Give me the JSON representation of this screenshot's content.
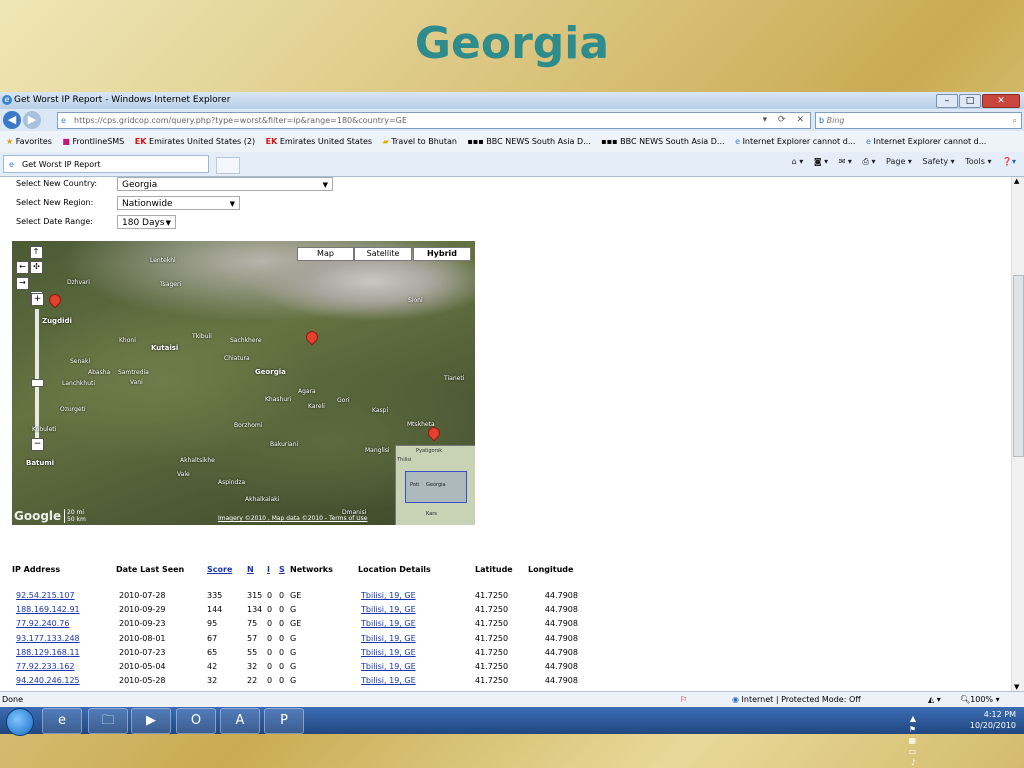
{
  "slide_title": "Georgia",
  "browser": {
    "window_title": "Get Worst IP Report - Windows Internet Explorer",
    "url": "https://cps.gridcop.com/query.php?type=worst&filter=ip&range=180&country=GE",
    "search_placeholder": "Bing",
    "favorites_label": "Favorites",
    "favorites": [
      "FrontlineSMS",
      "Emirates United States (2)",
      "Emirates United States",
      "Travel to Bhutan",
      "BBC NEWS South Asia D...",
      "BBC NEWS South Asia D...",
      "Internet Explorer cannot d...",
      "Internet Explorer cannot d..."
    ],
    "tab_title": "Get Worst IP Report",
    "commands": [
      "Page ▾",
      "Safety ▾",
      "Tools ▾"
    ],
    "status_left": "Done",
    "status_zone": "Internet | Protected Mode: Off",
    "zoom": "100%"
  },
  "form": {
    "country_label": "Select New Country:",
    "country_value": "Georgia",
    "region_label": "Select New Region:",
    "region_value": "Nationwide",
    "range_label": "Select Date Range:",
    "range_value": "180 Days"
  },
  "map": {
    "types": [
      "Map",
      "Satellite",
      "Hybrid"
    ],
    "active_type": "Hybrid",
    "place_labels": [
      "Lentekhi",
      "Dzhvari",
      "Tsageri",
      "Zugdidi",
      "Khoni",
      "Kutaisi",
      "Tkibuli",
      "Sachkhere",
      "Chiatura",
      "Georgia",
      "Senaki",
      "Abasha",
      "Samtredia",
      "Lanchkhuti",
      "Vani",
      "Ozurgeti",
      "Kobuleti",
      "Batumi",
      "Khashuri",
      "Agara",
      "Kareli",
      "Gori",
      "Kaspi",
      "Mtskheta",
      "Borzhomi",
      "Bakuriani",
      "Akhaltsikhe",
      "Vale",
      "Aspindza",
      "Akhalkalaki",
      "Dmanisi",
      "Manglisi",
      "Tianeti",
      "Sioni",
      "Pyatigorsk",
      "Thilisi",
      "Poti",
      "Kars"
    ],
    "scale_mi": "20 mi",
    "scale_km": "50 km",
    "copyright": "Imagery ©2010 , Map data ©2010 - Terms of Use",
    "logo": "Google"
  },
  "table": {
    "headers": {
      "ip": "IP Address",
      "date": "Date Last Seen",
      "score": "Score",
      "n": "N",
      "i": "I",
      "s": "S",
      "networks": "Networks",
      "location": "Location Details",
      "lat": "Latitude",
      "lon": "Longitude"
    },
    "rows": [
      {
        "ip": "92.54.215.107",
        "date": "2010-07-28",
        "score": "335",
        "n": "315",
        "i": "0",
        "s": "0",
        "networks": "GE",
        "location": "Tbilisi, 19, GE",
        "lat": "41.7250",
        "lon": "44.7908"
      },
      {
        "ip": "188.169.142.91",
        "date": "2010-09-29",
        "score": "144",
        "n": "134",
        "i": "0",
        "s": "0",
        "networks": "G",
        "location": "Tbilisi, 19, GE",
        "lat": "41.7250",
        "lon": "44.7908"
      },
      {
        "ip": "77.92.240.76",
        "date": "2010-09-23",
        "score": "95",
        "n": "75",
        "i": "0",
        "s": "0",
        "networks": "GE",
        "location": "Tbilisi, 19, GE",
        "lat": "41.7250",
        "lon": "44.7908"
      },
      {
        "ip": "93.177.133.248",
        "date": "2010-08-01",
        "score": "67",
        "n": "57",
        "i": "0",
        "s": "0",
        "networks": "G",
        "location": "Tbilisi, 19, GE",
        "lat": "41.7250",
        "lon": "44.7908"
      },
      {
        "ip": "188.129.168.11",
        "date": "2010-07-23",
        "score": "65",
        "n": "55",
        "i": "0",
        "s": "0",
        "networks": "G",
        "location": "Tbilisi, 19, GE",
        "lat": "41.7250",
        "lon": "44.7908"
      },
      {
        "ip": "77.92.233.162",
        "date": "2010-05-04",
        "score": "42",
        "n": "32",
        "i": "0",
        "s": "0",
        "networks": "G",
        "location": "Tbilisi, 19, GE",
        "lat": "41.7250",
        "lon": "44.7908"
      },
      {
        "ip": "94.240.246.125",
        "date": "2010-05-28",
        "score": "32",
        "n": "22",
        "i": "0",
        "s": "0",
        "networks": "G",
        "location": "Tbilisi, 19, GE",
        "lat": "41.7250",
        "lon": "44.7908"
      }
    ]
  },
  "taskbar": {
    "time": "4:12 PM",
    "date": "10/20/2010"
  }
}
